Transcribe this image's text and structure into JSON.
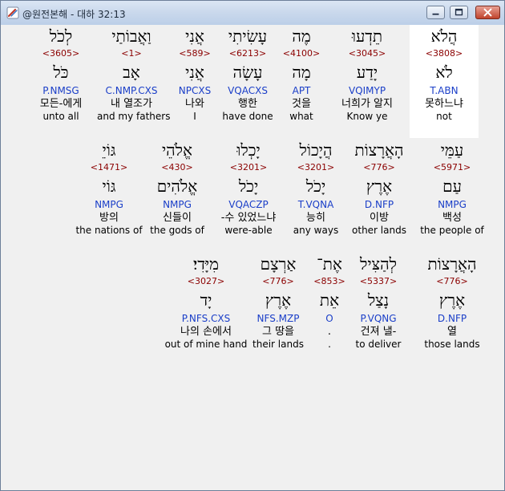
{
  "window": {
    "title": "@원전본해 - 대하 32:13",
    "colors": {
      "lexicon_number": "#8b0000",
      "morphology": "#1a3ec8",
      "highlight": "#ffffff"
    },
    "icons": [
      "app-icon",
      "minimize-icon",
      "maximize-icon",
      "close-icon"
    ]
  },
  "rows": [
    {
      "words": [
        {
          "hebrew": "הֲלֹא",
          "number": "<3808>",
          "lemma": "לֹא",
          "morph": "T.ABN",
          "korean": "못하느냐",
          "english": "not",
          "highlighted": true
        },
        {
          "hebrew": "תֵדְעוּ",
          "number": "<3045>",
          "lemma": "יָדַע",
          "morph": "VQIMYP",
          "korean": "너희가 알지",
          "english": "Know ye"
        },
        {
          "hebrew": "מֶה",
          "number": "<4100>",
          "lemma": "מָה",
          "morph": "APT",
          "korean": "것을",
          "english": "what"
        },
        {
          "hebrew": "עָשִׂיתִי",
          "number": "<6213>",
          "lemma": "עָשָׂה",
          "morph": "VQACXS",
          "korean": "행한",
          "english": "have done"
        },
        {
          "hebrew": "אֲנִי",
          "number": "<589>",
          "lemma": "אֲנִי",
          "morph": "NPCXS",
          "korean": "나와",
          "english": "I"
        },
        {
          "hebrew": "וַאֲבוֹתַי",
          "number": "<1>",
          "lemma": "אָב",
          "morph": "C.NMP.CXS",
          "korean": "내 열조가",
          "english": "and my fathers"
        },
        {
          "hebrew": "לְכֹל",
          "number": "<3605>",
          "lemma": "כֹּל",
          "morph": "P.NMSG",
          "korean": "모든-에게",
          "english": "unto all"
        }
      ]
    },
    {
      "words": [
        {
          "hebrew": "עַמֵּי",
          "number": "<5971>",
          "lemma": "עַם",
          "morph": "NMPG",
          "korean": "백성",
          "english": "the people of"
        },
        {
          "hebrew": "הָאֲרָצוֹת",
          "number": "<776>",
          "lemma": "אֶרֶץ",
          "morph": "D.NFP",
          "korean": "이방",
          "english": "other lands"
        },
        {
          "hebrew": "הֲיָכוֹל",
          "number": "<3201>",
          "lemma": "יָכֹל",
          "morph": "T.VQNA",
          "korean": "능히",
          "english": "any ways"
        },
        {
          "hebrew": "יָכְלוּ",
          "number": "<3201>",
          "lemma": "יָכֹל",
          "morph": "VQACZP",
          "korean": "-수 있었느냐",
          "english": "were-able"
        },
        {
          "hebrew": "אֱלֹהֵי",
          "number": "<430>",
          "lemma": "אֱלֹהִים",
          "morph": "NMPG",
          "korean": "신들이",
          "english": "the gods of"
        },
        {
          "hebrew": "גּוֹיֵ",
          "number": "<1471>",
          "lemma": "גּוֹי",
          "morph": "NMPG",
          "korean": "방의",
          "english": "the nations of"
        }
      ]
    },
    {
      "words": [
        {
          "hebrew": "הָאֲרָצוֹת",
          "number": "<776>",
          "lemma": "אֶרֶץ",
          "morph": "D.NFP",
          "korean": "열",
          "english": "those lands"
        },
        {
          "hebrew": "לְהַצִּיל",
          "number": "<5337>",
          "lemma": "נָצַל",
          "morph": "P.VQNG",
          "korean": "건져 낼-",
          "english": "to deliver"
        },
        {
          "hebrew": "אֶת־",
          "number": "<853>",
          "lemma": "אֵת",
          "morph": "O",
          "korean": ".",
          "english": "."
        },
        {
          "hebrew": "אַרְצָם",
          "number": "<776>",
          "lemma": "אֶרֶץ",
          "morph": "NFS.MZP",
          "korean": "그 땅을",
          "english": "their lands"
        },
        {
          "hebrew": "מִיָּדִי׃",
          "number": "<3027>",
          "lemma": "יָד",
          "morph": "P.NFS.CXS",
          "korean": "나의 손에서",
          "english": "out of mine hand"
        }
      ]
    }
  ]
}
